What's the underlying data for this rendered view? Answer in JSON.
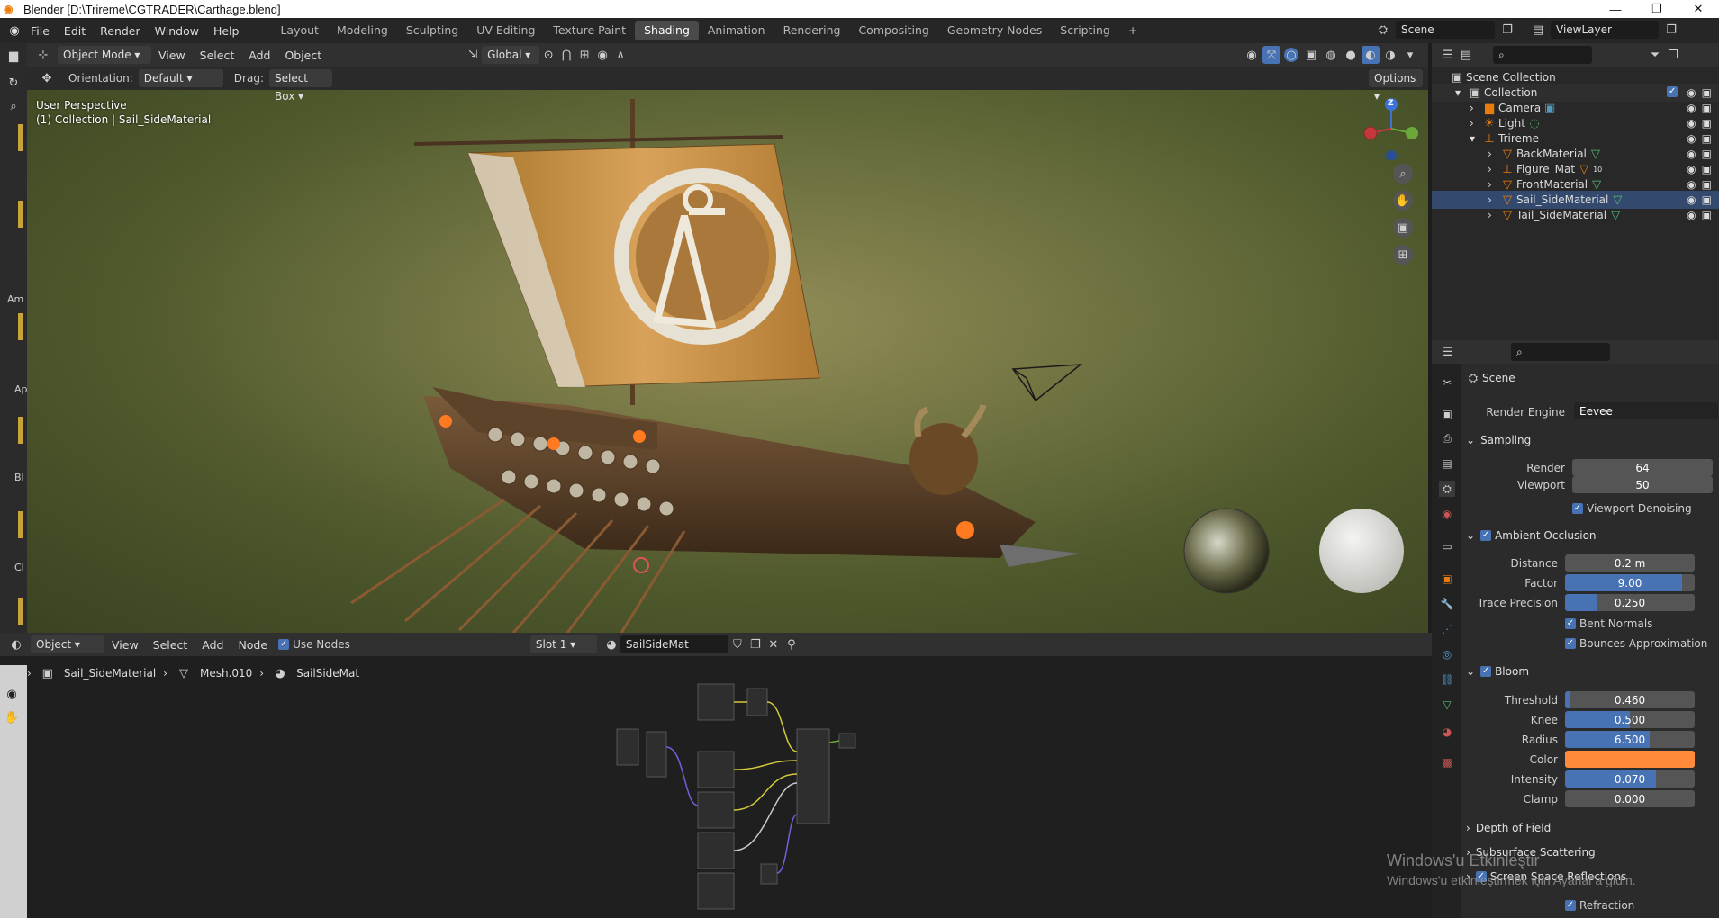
{
  "window": {
    "title": "Blender [D:\\Trireme\\CGTRADER\\Carthage.blend]",
    "minimize": "—",
    "maximize": "❐",
    "close": "✕"
  },
  "menubar": {
    "items": [
      "File",
      "Edit",
      "Render",
      "Window",
      "Help"
    ]
  },
  "workspaces": {
    "tabs": [
      "Layout",
      "Modeling",
      "Sculpting",
      "UV Editing",
      "Texture Paint",
      "Shading",
      "Animation",
      "Rendering",
      "Compositing",
      "Geometry Nodes",
      "Scripting"
    ],
    "add": "+"
  },
  "scene": {
    "label": "Scene",
    "view_layer": "ViewLayer"
  },
  "viewport_header": {
    "mode": "Object Mode",
    "view": "View",
    "select": "Select",
    "add": "Add",
    "object": "Object",
    "transform": "Global",
    "orientation_label": "Orientation:",
    "orientation": "Default",
    "drag_label": "Drag:",
    "drag": "Select Box",
    "options": "Options"
  },
  "viewport": {
    "perspective": "User Perspective",
    "collection": "(1) Collection | Sail_SideMaterial",
    "gizmo": {
      "z": "Z"
    }
  },
  "left_tool_labels": [
    "Am",
    "Ap",
    "Bl",
    "Cl"
  ],
  "node_editor": {
    "type": "Object",
    "view": "View",
    "select": "Select",
    "add": "Add",
    "node": "Node",
    "use_nodes": "Use Nodes",
    "slot": "Slot 1",
    "material": "SailSideMat",
    "breadcrumb": [
      "Sail_SideMaterial",
      "Mesh.010",
      "SailSideMat"
    ]
  },
  "outliner": {
    "root": "Scene Collection",
    "items": [
      {
        "name": "Collection",
        "level": 0
      },
      {
        "name": "Camera",
        "level": 1
      },
      {
        "name": "Light",
        "level": 1
      },
      {
        "name": "Trireme",
        "level": 1
      },
      {
        "name": "BackMaterial",
        "level": 2
      },
      {
        "name": "Figure_Mat",
        "level": 2,
        "badge": "10"
      },
      {
        "name": "FrontMaterial",
        "level": 2
      },
      {
        "name": "Sail_SideMaterial",
        "level": 2
      },
      {
        "name": "Tail_SideMaterial",
        "level": 2
      }
    ]
  },
  "properties": {
    "context": "Scene",
    "render_engine_label": "Render Engine",
    "render_engine": "Eevee",
    "sampling": {
      "title": "Sampling",
      "render_label": "Render",
      "render": "64",
      "viewport_label": "Viewport",
      "viewport": "50",
      "denoise": "Viewport Denoising"
    },
    "ao": {
      "title": "Ambient Occlusion",
      "distance_label": "Distance",
      "distance": "0.2 m",
      "factor_label": "Factor",
      "factor": "9.00",
      "trace_label": "Trace Precision",
      "trace": "0.250",
      "bent": "Bent Normals",
      "bounces": "Bounces Approximation"
    },
    "bloom": {
      "title": "Bloom",
      "threshold_label": "Threshold",
      "threshold": "0.460",
      "knee_label": "Knee",
      "knee": "0.500",
      "radius_label": "Radius",
      "radius": "6.500",
      "color_label": "Color",
      "intensity_label": "Intensity",
      "intensity": "0.070",
      "clamp_label": "Clamp",
      "clamp": "0.000"
    },
    "dof": "Depth of Field",
    "sss": "Subsurface Scattering",
    "ssr": "Screen Space Reflections",
    "refraction": "Refraction"
  },
  "watermark": {
    "line1": "Windows'u Etkinleştir",
    "line2": "Windows'u etkinleştirmek için Ayarlar'a gidin."
  },
  "colors": {
    "accent": "#4772b3",
    "bloom_color": "#ff8a3a",
    "active_ws": "#4a4a4a",
    "orange_obj": "#e87d0d"
  }
}
